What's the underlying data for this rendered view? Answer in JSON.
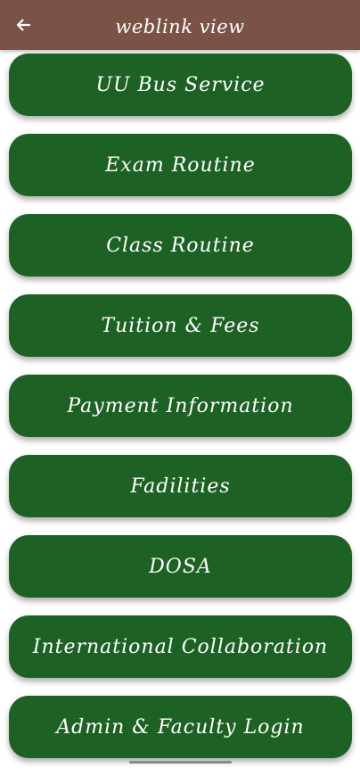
{
  "app_bar": {
    "title": "weblink view",
    "back_icon": "arrow-left-icon",
    "color": "#7a5346"
  },
  "menu": {
    "color": "#1e6124",
    "items": [
      {
        "label": "UU Bus Service"
      },
      {
        "label": "Exam Routine"
      },
      {
        "label": "Class Routine"
      },
      {
        "label": "Tuition & Fees"
      },
      {
        "label": "Payment Information"
      },
      {
        "label": "Fadilities"
      },
      {
        "label": "DOSA"
      },
      {
        "label": "International Collaboration"
      },
      {
        "label": "Admin & Faculty Login"
      }
    ]
  }
}
